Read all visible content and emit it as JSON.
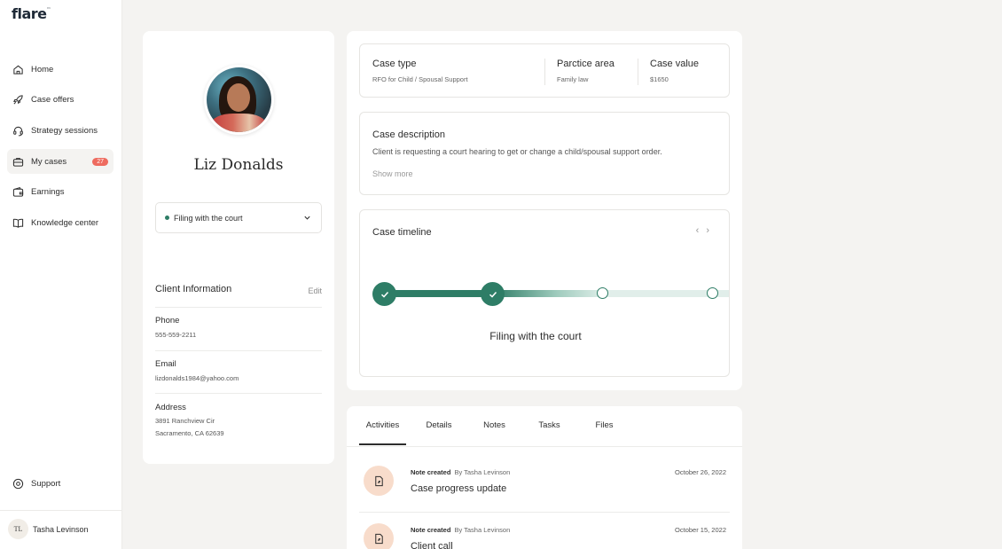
{
  "app": {
    "logo": "flare",
    "logo_tm": "™"
  },
  "sidebar": {
    "items": [
      {
        "label": "Home",
        "icon": "home-icon"
      },
      {
        "label": "Case offers",
        "icon": "rocket-icon"
      },
      {
        "label": "Strategy sessions",
        "icon": "headset-icon"
      },
      {
        "label": "My cases",
        "icon": "briefcase-icon",
        "badge": "27",
        "active": true
      },
      {
        "label": "Earnings",
        "icon": "wallet-icon"
      },
      {
        "label": "Knowledge center",
        "icon": "book-icon"
      }
    ],
    "support_label": "Support",
    "user": {
      "initials": "TL",
      "name": "Tasha Levinson"
    }
  },
  "client": {
    "name": "Liz Donalds",
    "status": "Filing with the court",
    "info_title": "Client Information",
    "edit_label": "Edit",
    "phone_label": "Phone",
    "phone": "555-559-2211",
    "email_label": "Email",
    "email": "lizdonalds1984@yahoo.com",
    "address_label": "Address",
    "address_line1": "3891 Ranchview Cir",
    "address_line2": "Sacramento, CA 62639"
  },
  "case": {
    "type_label": "Case type",
    "type_value": "RFO for Child / Spousal Support",
    "area_label": "Parctice area",
    "area_value": "Family law",
    "value_label": "Case value",
    "value_value": "$1650",
    "description_title": "Case description",
    "description_text": "Client is requesting a court hearing to get or change a child/spousal support order.",
    "show_more": "Show more",
    "timeline_title": "Case timeline",
    "timeline_stage": "Filing with the court",
    "timeline_completed_steps": 2,
    "timeline_total_visible_steps": 4
  },
  "activity": {
    "tabs": [
      "Activities",
      "Details",
      "Notes",
      "Tasks",
      "Files"
    ],
    "active_tab": "Activities",
    "items": [
      {
        "kind": "Note created",
        "by": "By Tasha Levinson",
        "title": "Case progress update",
        "date": "October 26, 2022"
      },
      {
        "kind": "Note created",
        "by": "By Tasha Levinson",
        "title": "Client call",
        "date": "October 15, 2022"
      }
    ]
  },
  "colors": {
    "accent": "#2e7d66",
    "badge": "#ee6b5f",
    "background": "#f4f3f1"
  }
}
